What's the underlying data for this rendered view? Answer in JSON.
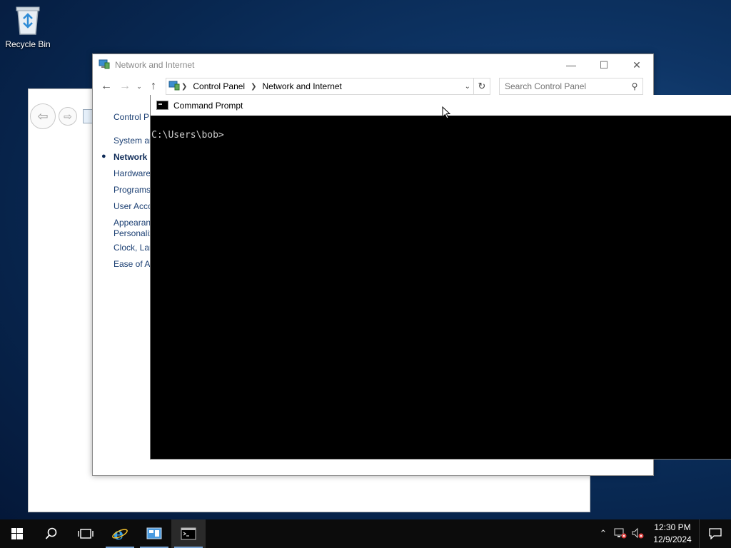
{
  "desktop": {
    "recycle_bin_label": "Recycle Bin"
  },
  "control_panel": {
    "title": "Network and Internet",
    "breadcrumb": [
      "Control Panel",
      "Network and Internet"
    ],
    "search_placeholder": "Search Control Panel",
    "sidebar": [
      "Control P",
      "System ar",
      "Network",
      "Hardware",
      "Programs",
      "User Acco",
      "Appearan",
      "Personaliz",
      "Clock, Lar",
      "Ease of Ac"
    ]
  },
  "cmd": {
    "title": "Command Prompt",
    "prompt": "C:\\Users\\bob>"
  },
  "taskbar": {
    "time": "12:30 PM",
    "date": "12/9/2024"
  }
}
